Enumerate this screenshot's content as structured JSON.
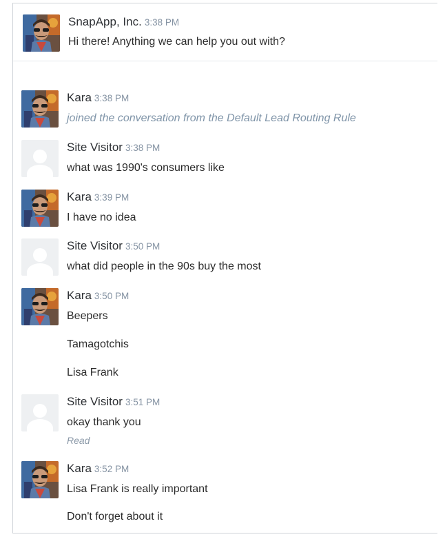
{
  "greeting": {
    "sender": "SnapApp, Inc.",
    "time": "3:38 PM",
    "text": "Hi there! Anything we can help you out with?"
  },
  "messages": [
    {
      "sender": "Kara",
      "time": "3:38 PM",
      "avatar": "agent-photo",
      "lines": [
        "joined the conversation from the Default Lead Routing Rule"
      ],
      "system": true
    },
    {
      "sender": "Site Visitor",
      "time": "3:38 PM",
      "avatar": "visitor-placeholder",
      "lines": [
        "what was 1990's consumers like"
      ]
    },
    {
      "sender": "Kara",
      "time": "3:39 PM",
      "avatar": "agent-photo",
      "lines": [
        "I have no idea"
      ]
    },
    {
      "sender": "Site Visitor",
      "time": "3:50 PM",
      "avatar": "visitor-placeholder",
      "lines": [
        "what did people in the 90s buy the most"
      ]
    },
    {
      "sender": "Kara",
      "time": "3:50 PM",
      "avatar": "agent-photo",
      "lines": [
        "Beepers",
        "Tamagotchis",
        "Lisa Frank"
      ]
    },
    {
      "sender": "Site Visitor",
      "time": "3:51 PM",
      "avatar": "visitor-placeholder",
      "lines": [
        "okay thank you"
      ],
      "status": "Read"
    },
    {
      "sender": "Kara",
      "time": "3:52 PM",
      "avatar": "agent-photo",
      "lines": [
        "Lisa Frank is really important",
        "Don't forget about it"
      ]
    }
  ],
  "colors": {
    "timestamp": "#8593a3",
    "system_text": "#7f94a8",
    "border": "#cfd3d8"
  }
}
